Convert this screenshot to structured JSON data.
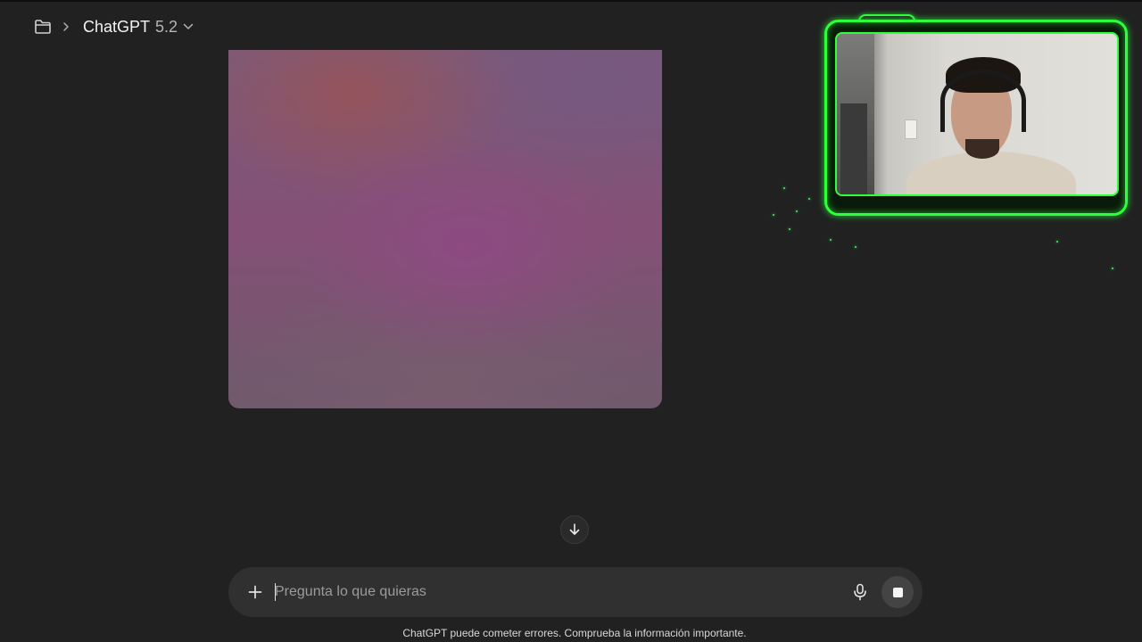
{
  "header": {
    "folder_icon": "folder-icon",
    "separator_icon": "chevron-right-icon",
    "model_name": "ChatGPT",
    "model_version": "5.2",
    "dropdown_icon": "chevron-down-icon"
  },
  "scroll_button": {
    "icon": "arrow-down-icon"
  },
  "composer": {
    "plus_icon": "plus-icon",
    "placeholder": "Pregunta lo que quieras",
    "value": "",
    "mic_icon": "microphone-icon",
    "stop_icon": "stop-icon"
  },
  "footer": {
    "disclaimer": "ChatGPT puede cometer errores. Comprueba la información importante."
  },
  "colors": {
    "background": "#212121",
    "composer_bg": "#303030",
    "webcam_border": "#2dff3a"
  }
}
